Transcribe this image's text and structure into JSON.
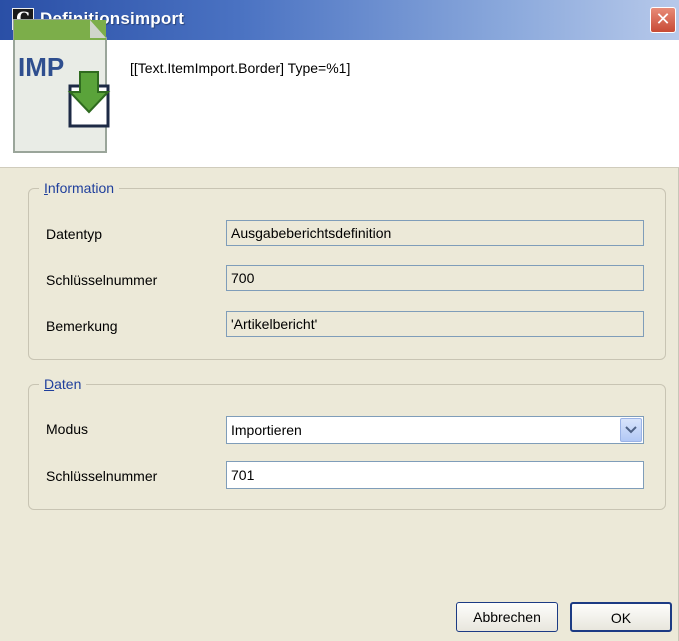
{
  "window": {
    "title": "Definitionsimport",
    "app_icon_letter": "C",
    "close_symbol": "✕"
  },
  "header": {
    "icon_name": "imp-import-icon",
    "icon_text": "IMP",
    "text": "[[Text.ItemImport.Border] Type=%1]"
  },
  "information": {
    "legend_first": "I",
    "legend_rest": "nformation",
    "rows": [
      {
        "label": "Datentyp",
        "value": "Ausgabeberichtsdefinition"
      },
      {
        "label": "Schlüsselnummer",
        "value": "700"
      },
      {
        "label": "Bemerkung",
        "value": "'Artikelbericht'"
      }
    ]
  },
  "daten": {
    "legend_first": "D",
    "legend_rest": "aten",
    "modus_label": "Modus",
    "modus_value": "Importieren",
    "key_label": "Schlüsselnummer",
    "key_value": "701"
  },
  "buttons": {
    "cancel": "Abbrechen",
    "ok": "OK"
  }
}
